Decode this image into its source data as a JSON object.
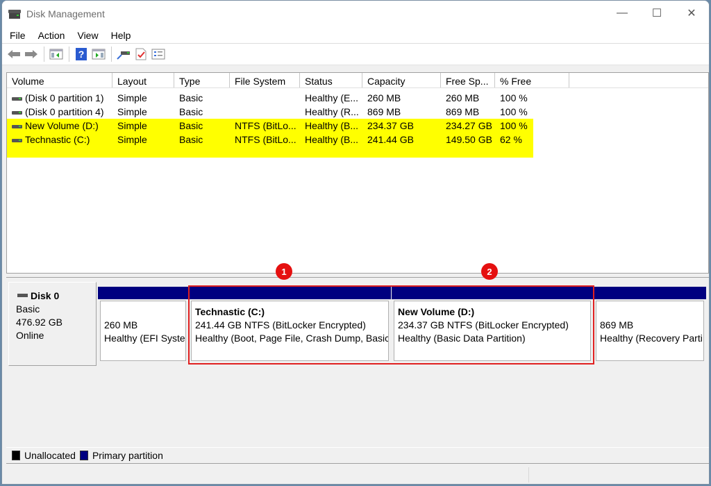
{
  "window": {
    "title": "Disk Management",
    "controls": {
      "minimize": "—",
      "maximize": "☐",
      "close": "✕"
    }
  },
  "menu": [
    "File",
    "Action",
    "View",
    "Help"
  ],
  "toolbar": {
    "icons": [
      "back-arrow-icon",
      "forward-arrow-icon",
      "show-hide-console-tree-icon",
      "help-icon",
      "show-hide-action-pane-icon",
      "connect-disk-icon",
      "properties-checklist-icon",
      "list-view-icon"
    ]
  },
  "volume_table": {
    "columns": [
      "Volume",
      "Layout",
      "Type",
      "File System",
      "Status",
      "Capacity",
      "Free Sp...",
      "% Free"
    ],
    "rows": [
      {
        "volume": "(Disk 0 partition 1)",
        "layout": "Simple",
        "type": "Basic",
        "fs": "",
        "status": "Healthy (E...",
        "capacity": "260 MB",
        "free": "260 MB",
        "pct": "100 %",
        "highlighted": false
      },
      {
        "volume": "(Disk 0 partition 4)",
        "layout": "Simple",
        "type": "Basic",
        "fs": "",
        "status": "Healthy (R...",
        "capacity": "869 MB",
        "free": "869 MB",
        "pct": "100 %",
        "highlighted": false
      },
      {
        "volume": "New Volume (D:)",
        "layout": "Simple",
        "type": "Basic",
        "fs": "NTFS (BitLo...",
        "status": "Healthy (B...",
        "capacity": "234.37 GB",
        "free": "234.27 GB",
        "pct": "100 %",
        "highlighted": true
      },
      {
        "volume": "Technastic (C:)",
        "layout": "Simple",
        "type": "Basic",
        "fs": "NTFS (BitLo...",
        "status": "Healthy (B...",
        "capacity": "241.44 GB",
        "free": "149.50 GB",
        "pct": "62 %",
        "highlighted": true
      }
    ]
  },
  "disk": {
    "name": "Disk 0",
    "type": "Basic",
    "size": "476.92 GB",
    "state": "Online",
    "partitions": [
      {
        "name": "",
        "line1": "260 MB",
        "line2": "Healthy (EFI Syste"
      },
      {
        "name": "Technastic  (C:)",
        "line1": "241.44 GB NTFS (BitLocker Encrypted)",
        "line2": "Healthy (Boot, Page File, Crash Dump, Basic"
      },
      {
        "name": "New Volume  (D:)",
        "line1": "234.37 GB NTFS (BitLocker Encrypted)",
        "line2": "Healthy (Basic Data Partition)"
      },
      {
        "name": "",
        "line1": "869 MB",
        "line2": "Healthy (Recovery Parti"
      }
    ]
  },
  "annotations": {
    "badge1": "1",
    "badge2": "2"
  },
  "legend": [
    {
      "label": "Unallocated",
      "color": "#000000"
    },
    {
      "label": "Primary partition",
      "color": "#000080"
    }
  ],
  "colors": {
    "highlight": "#ffff00",
    "partition_bar": "#000080",
    "annotation_red": "#e51010"
  }
}
